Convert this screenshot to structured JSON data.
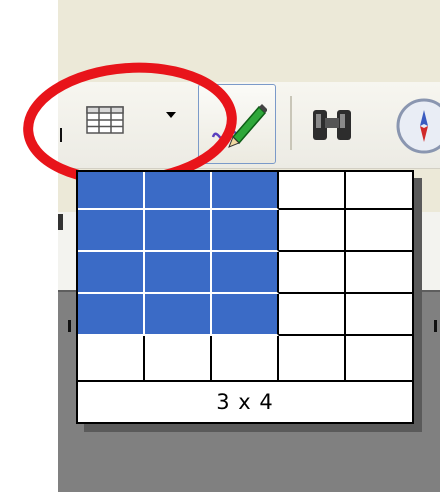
{
  "toolbar": {
    "insert_table_button": {
      "icon": "table-grid-icon",
      "has_dropdown": true
    },
    "show_draw_functions_button": {
      "icon": "pencil-icon"
    },
    "find_replace_button": {
      "icon": "binoculars-icon"
    },
    "navigator_button": {
      "icon": "compass-icon"
    }
  },
  "annotation": {
    "shape": "ellipse",
    "color": "#e8141a"
  },
  "table_picker": {
    "rows": 5,
    "cols": 5,
    "selected_rows": 4,
    "selected_cols": 3,
    "selected_color": "#3b6bc6",
    "size_label": "3 x 4"
  }
}
